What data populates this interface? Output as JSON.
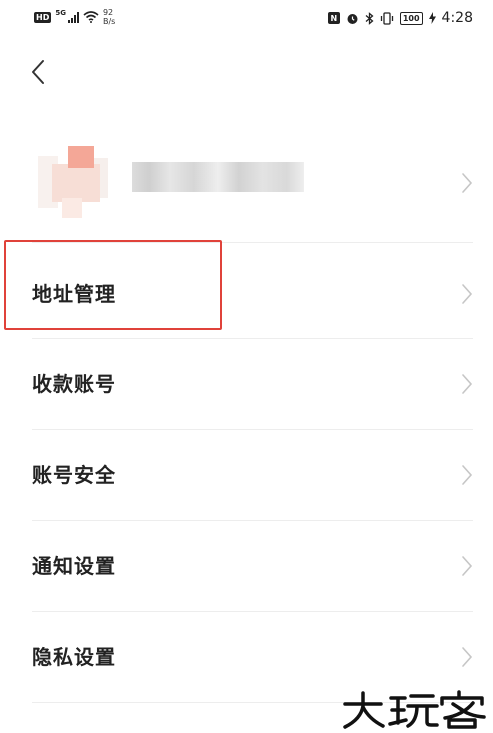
{
  "status_bar": {
    "network_badge": "HD",
    "network_type": "5G",
    "speed_value": "92",
    "speed_unit": "B/s",
    "battery": "100",
    "time": "4:28"
  },
  "menu": {
    "items": [
      {
        "label": "地址管理"
      },
      {
        "label": "收款账号"
      },
      {
        "label": "账号安全"
      },
      {
        "label": "通知设置"
      },
      {
        "label": "隐私设置"
      }
    ]
  },
  "watermark": {
    "text": "大玩客"
  },
  "colors": {
    "highlight": "#e0423a",
    "divider": "#ededed",
    "text": "#222222"
  }
}
